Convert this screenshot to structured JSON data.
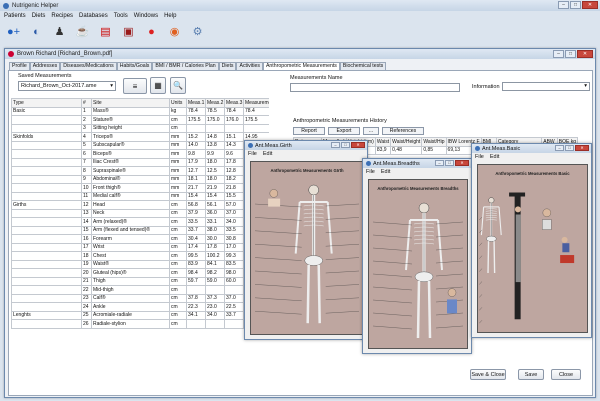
{
  "app": {
    "title": "Nutrigenic Helper",
    "menu": [
      "Patients",
      "Diets",
      "Recipes",
      "Databases",
      "Tools",
      "Windows",
      "Help"
    ]
  },
  "toolbar": {
    "icons": [
      "add-patient-icon",
      "patients-icon",
      "groups-icon",
      "food-icon",
      "recipe-icon",
      "database-icon",
      "apple-icon",
      "scale-icon",
      "settings-icon"
    ]
  },
  "patient_window": {
    "title": "Brown Richard  [Richard_Brown.pdf]",
    "tabs": [
      "Profile",
      "Addresses",
      "Diseases/Medications",
      "Habits/Goals",
      "BMI / BMR / Calories Plan",
      "Diets",
      "Activities",
      "Anthropometric Measurements",
      "Biochemical tests"
    ],
    "active_tab_index": 7,
    "saved_label": "Saved Measurements",
    "saved_value": "Richard_Brown_Oct-2017.ame",
    "mname_label": "Measurements Name",
    "information_label": "Information",
    "history_title": "Anthropometric Measurements History",
    "history_buttons": [
      "Report",
      "Export",
      "...",
      "References"
    ],
    "history_headers": [
      "Date",
      "Mass (kg)",
      "Height (cm)",
      "Waist",
      "Waist/Height",
      "Waist/Hip",
      "IBW Lorentz F",
      "BMI",
      "Category",
      "ABW",
      "BOE kg"
    ],
    "history_rows": [
      [
        "07/10/2017",
        "78,4",
        "175,5",
        "83,9",
        "0,48",
        "0,85",
        "69,13",
        "25,45",
        "Overweight grade I",
        "71,44",
        "1,06"
      ]
    ],
    "table_headers": [
      "Type",
      "#",
      "Site",
      "Units",
      "Meas.1",
      "Meas.2",
      "Meas.3",
      "Measurement"
    ],
    "rows": [
      [
        "Basic",
        "1",
        "Mass®",
        "kg",
        "78.4",
        "78.5",
        "78.4",
        "78.4"
      ],
      [
        "",
        "2",
        "Stature®",
        "cm",
        "175.5",
        "175.0",
        "176.0",
        "175.5"
      ],
      [
        "",
        "3",
        "Sitting height",
        "cm",
        "",
        "",
        "",
        ""
      ],
      [
        "Skinfolds",
        "4",
        "Triceps®",
        "mm",
        "15.2",
        "14.8",
        "15.1",
        "14.95"
      ],
      [
        "",
        "5",
        "Subscapular®",
        "mm",
        "14.0",
        "13.8",
        "14.3",
        "14"
      ],
      [
        "",
        "6",
        "Biceps®",
        "mm",
        "9.8",
        "9.9",
        "9.6",
        "9.8"
      ],
      [
        "",
        "7",
        "Iliac Crest®",
        "mm",
        "17.9",
        "18.0",
        "17.8",
        "17.9"
      ],
      [
        "",
        "8",
        "Supraspinale®",
        "mm",
        "12.7",
        "12.5",
        "12.8",
        "12.7"
      ],
      [
        "",
        "9",
        "Abdominal®",
        "mm",
        "18.1",
        "18.0",
        "18.2",
        "18.1"
      ],
      [
        "",
        "10",
        "Front thigh®",
        "mm",
        "21.7",
        "21.9",
        "21.8",
        "21.8"
      ],
      [
        "",
        "11",
        "Medial calf®",
        "mm",
        "15.4",
        "15.4",
        "15.5",
        "15.4"
      ],
      [
        "Girths",
        "12",
        "Head",
        "cm",
        "56.8",
        "56.1",
        "57.0",
        "56.8"
      ],
      [
        "",
        "13",
        "Neck",
        "cm",
        "37.9",
        "36.0",
        "37.0",
        "37"
      ],
      [
        "",
        "14",
        "Arm (relaxed)®",
        "cm",
        "33.5",
        "33.1",
        "34.0",
        "33.5"
      ],
      [
        "",
        "15",
        "Arm (flexed and tensed)®",
        "cm",
        "33.7",
        "38.0",
        "33.5",
        "33.7"
      ],
      [
        "",
        "16",
        "Forearm",
        "cm",
        "30.4",
        "30.0",
        "30.8",
        "30.4"
      ],
      [
        "",
        "17",
        "Wrist",
        "cm",
        "17.4",
        "17.8",
        "17.0",
        "17.4"
      ],
      [
        "",
        "18",
        "Chest",
        "cm",
        "99.5",
        "100.2",
        "99.3",
        "99.5"
      ],
      [
        "",
        "19",
        "Waist®",
        "cm",
        "83.9",
        "84.1",
        "83.5",
        "83.9"
      ],
      [
        "",
        "20",
        "Gluteal (hips)®",
        "cm",
        "98.4",
        "98.2",
        "98.0",
        "98.2"
      ],
      [
        "",
        "21",
        "Thigh",
        "cm",
        "59.7",
        "59.0",
        "60.0",
        "59.7"
      ],
      [
        "",
        "22",
        "Mid-thigh",
        "cm",
        "",
        "",
        "",
        ""
      ],
      [
        "",
        "23",
        "Calf®",
        "cm",
        "37.8",
        "37.3",
        "37.0",
        "37.3"
      ],
      [
        "",
        "24",
        "Ankle",
        "cm",
        "22.3",
        "23.0",
        "22.5",
        "22.5"
      ],
      [
        "Lenghts",
        "25",
        "Acromiale-radiale",
        "cm",
        "34.1",
        "34.0",
        "33.7",
        "34"
      ],
      [
        "",
        "26",
        "Radiale-stylion",
        "cm",
        "",
        "",
        "",
        ""
      ]
    ],
    "bottom_buttons": [
      "Save & Close",
      "Save",
      "Close"
    ]
  },
  "popups": [
    {
      "title": "Ant.Meas.Girth",
      "menu": [
        "File",
        "Edit"
      ],
      "heading": "Anthropometric Measurements GIrth"
    },
    {
      "title": "Ant.Meas.Breadths",
      "menu": [
        "File",
        "Edit"
      ],
      "heading": "Anthropometric Measurements Breadths"
    },
    {
      "title": "Ant.Meas.Basic",
      "menu": [
        "File",
        "Edit"
      ],
      "heading": "Anthropometric Measurements Basic"
    }
  ]
}
